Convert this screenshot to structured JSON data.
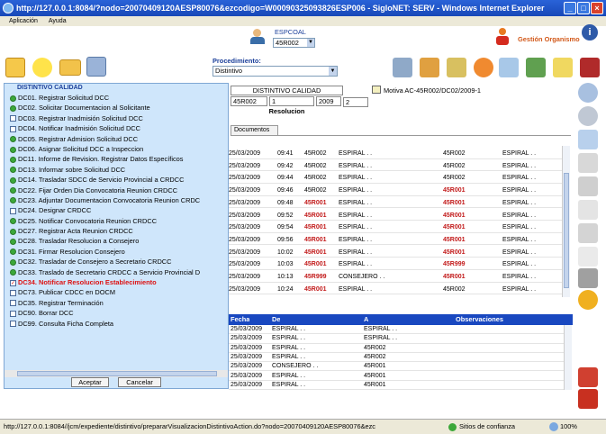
{
  "window": {
    "title": "http://127.0.0.1:8084/?nodo=20070409120AESP80076&ezcodigo=W00090325093826ESP006 - SigloNET: SERV - Windows Internet Explorer"
  },
  "menu": {
    "items": [
      "Aplicación",
      "Ayuda"
    ]
  },
  "header": {
    "espcoal_label": "ESPCOAL",
    "espcoal_value": "45R002",
    "gestion_label": "Gestión Organismo",
    "procedimiento_label": "Procedimiento:",
    "procedimiento_value": "Distintivo"
  },
  "tree": {
    "root": "DISTINTIVO CALIDAD",
    "items": [
      {
        "label": "DC01. Registrar Solicitud DCC",
        "icon": "green"
      },
      {
        "label": "DC02. Solicitar Documentacion al Solicitante",
        "icon": "green"
      },
      {
        "label": "DC03. Registrar Inadmisión Solicitud DCC",
        "icon": "box"
      },
      {
        "label": "DC04. Notificar Inadmisión Solicitud DCC",
        "icon": "box"
      },
      {
        "label": "DC05. Registrar Admision Solicitud DCC",
        "icon": "green"
      },
      {
        "label": "DC06. Asignar Solicitud DCC a Inspeccion",
        "icon": "green"
      },
      {
        "label": "DC11. Informe de Revision. Registrar Datos Específicos",
        "icon": "green"
      },
      {
        "label": "DC13. Informar sobre Solicitud DCC",
        "icon": "green"
      },
      {
        "label": "DC14. Trasladar SDCC de Servicio Provincial a CRDCC",
        "icon": "green"
      },
      {
        "label": "DC22. Fijar Orden Dia Convocatoria Reunion CRDCC",
        "icon": "green"
      },
      {
        "label": "DC23. Adjuntar Documentacion Convocatoria Reunion CRDC",
        "icon": "green"
      },
      {
        "label": "DC24. Designar CRDCC",
        "icon": "box"
      },
      {
        "label": "DC25. Notificar Convocatoria Reunion CRDCC",
        "icon": "green"
      },
      {
        "label": "DC27. Registrar Acta Reunion CRDCC",
        "icon": "green"
      },
      {
        "label": "DC28. Trasladar Resolucion a Consejero",
        "icon": "green"
      },
      {
        "label": "DC31. Firmar Resolucion Consejero",
        "icon": "green"
      },
      {
        "label": "DC32. Trasladar de Consejero a Secretario CRDCC",
        "icon": "green"
      },
      {
        "label": "DC33. Traslado de Secretario CRDCC a Servicio Provincial D",
        "icon": "green"
      },
      {
        "label": "DC34. Notificar Resolucion Establecimiento",
        "icon": "check",
        "selected": true
      },
      {
        "label": "DC73. Publicar CDCC en DOCM",
        "icon": "box"
      },
      {
        "label": "DC35. Registrar Terminación",
        "icon": "box"
      },
      {
        "label": "DC90. Borrar DCC",
        "icon": "box"
      },
      {
        "label": "DC99. Consulta Ficha Completa",
        "icon": "box"
      }
    ],
    "accept_label": "Aceptar",
    "cancel_label": "Cancelar"
  },
  "record": {
    "header": "DISTINTIVO CALIDAD",
    "fields": [
      "45R002",
      "1",
      "2009",
      "2"
    ],
    "subheader": "Resolucion",
    "motive": "Motiva AC-45R002/DC02/2009-1",
    "tab": "Documentos"
  },
  "grid1": {
    "rows": [
      [
        "25/03/2009",
        "09:41",
        "45R002",
        "ESPIRAL . .",
        "45R002",
        "ESPIRAL . ."
      ],
      [
        "25/03/2009",
        "09:42",
        "45R002",
        "ESPIRAL . .",
        "45R002",
        "ESPIRAL . ."
      ],
      [
        "25/03/2009",
        "09:44",
        "45R002",
        "ESPIRAL . .",
        "45R002",
        "ESPIRAL . ."
      ],
      [
        "25/03/2009",
        "09:46",
        "45R002",
        "ESPIRAL . .",
        "45R001",
        "ESPIRAL . ."
      ],
      [
        "25/03/2009",
        "09:48",
        "45R001",
        "ESPIRAL . .",
        "45R001",
        "ESPIRAL . ."
      ],
      [
        "25/03/2009",
        "09:52",
        "45R001",
        "ESPIRAL . .",
        "45R001",
        "ESPIRAL . ."
      ],
      [
        "25/03/2009",
        "09:54",
        "45R001",
        "ESPIRAL . .",
        "45R001",
        "ESPIRAL . ."
      ],
      [
        "25/03/2009",
        "09:56",
        "45R001",
        "ESPIRAL . .",
        "45R001",
        "ESPIRAL . ."
      ],
      [
        "25/03/2009",
        "10:02",
        "45R001",
        "ESPIRAL . .",
        "45R001",
        "ESPIRAL . ."
      ],
      [
        "25/03/2009",
        "10:03",
        "45R001",
        "ESPIRAL . .",
        "45R999",
        "ESPIRAL . ."
      ],
      [
        "25/03/2009",
        "10:13",
        "45R999",
        "CONSEJERO . .",
        "45R001",
        "ESPIRAL . ."
      ],
      [
        "25/03/2009",
        "10:24",
        "45R001",
        "ESPIRAL . .",
        "45R002",
        "ESPIRAL . ."
      ]
    ],
    "red_cells": [
      [
        3,
        4
      ],
      [
        4,
        2
      ],
      [
        4,
        4
      ],
      [
        5,
        2
      ],
      [
        5,
        4
      ],
      [
        6,
        2
      ],
      [
        6,
        4
      ],
      [
        7,
        2
      ],
      [
        7,
        4
      ],
      [
        8,
        2
      ],
      [
        8,
        4
      ],
      [
        9,
        2
      ],
      [
        9,
        4
      ],
      [
        10,
        2
      ],
      [
        10,
        4
      ],
      [
        11,
        2
      ]
    ]
  },
  "grid2": {
    "headers": [
      "Fecha",
      "De",
      "A",
      "Observaciones"
    ],
    "rows": [
      [
        "25/03/2009",
        "ESPIRAL . .",
        "ESPIRAL . ."
      ],
      [
        "25/03/2009",
        "ESPIRAL . .",
        "ESPIRAL . ."
      ],
      [
        "25/03/2009",
        "ESPIRAL . .",
        "45R002"
      ],
      [
        "25/03/2009",
        "ESPIRAL . .",
        "45R002"
      ],
      [
        "25/03/2009",
        "CONSEJERO . .",
        "45R001"
      ],
      [
        "25/03/2009",
        "ESPIRAL . .",
        "45R001"
      ],
      [
        "25/03/2009",
        "ESPIRAL . .",
        "45R001"
      ]
    ]
  },
  "status": {
    "url": "http://127.0.0.1:8084//jcm/expediente/distintivo/prepararVisualizacionDistintivoAction.do?nodo=20070409120AESP80076&ezc",
    "zone": "Sitios de confianza",
    "zoom": "100%"
  }
}
